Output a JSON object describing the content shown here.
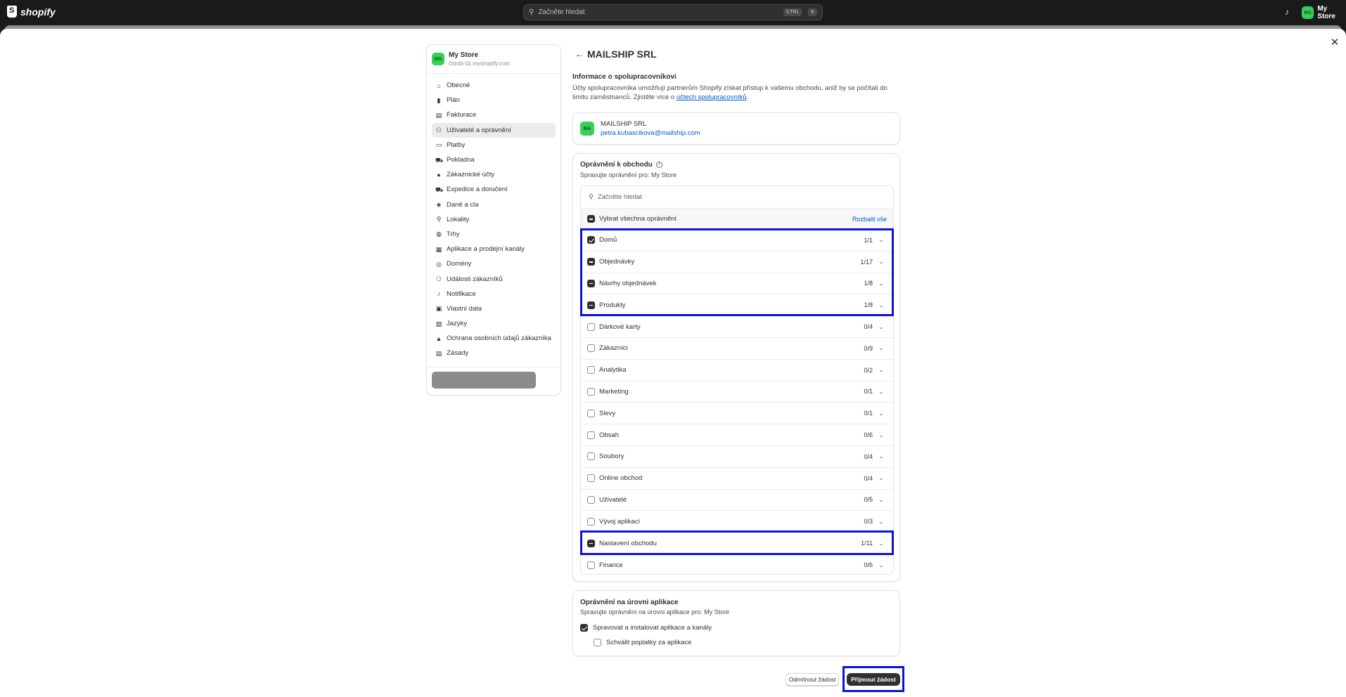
{
  "topbar": {
    "logo_text": "shopify",
    "search_placeholder": "Začněte hledat",
    "kbd1": "CTRL",
    "kbd2": "K",
    "store_initials": "MS",
    "store_name": "My Store"
  },
  "sidebar": {
    "store_initials": "MS",
    "store_name": "My Store",
    "store_domain": "0xtvbi-0z.myshopify.com",
    "items": [
      {
        "label": "Obecné",
        "icon": "store-icon",
        "glyph": "⌂"
      },
      {
        "label": "Plán",
        "icon": "plan-chart-icon",
        "glyph": "▮"
      },
      {
        "label": "Fakturace",
        "icon": "billing-icon",
        "glyph": "▤"
      },
      {
        "label": "Uživatelé a oprávnění",
        "icon": "users-icon",
        "glyph": "⚇"
      },
      {
        "label": "Platby",
        "icon": "payments-icon",
        "glyph": "▭"
      },
      {
        "label": "Pokladna",
        "icon": "checkout-cart-icon",
        "glyph": "⛟"
      },
      {
        "label": "Zákaznické účty",
        "icon": "customer-account-icon",
        "glyph": "●"
      },
      {
        "label": "Expedice a doručení",
        "icon": "truck-icon",
        "glyph": "⛟"
      },
      {
        "label": "Daně a cla",
        "icon": "taxes-icon",
        "glyph": "◈"
      },
      {
        "label": "Lokality",
        "icon": "location-pin-icon",
        "glyph": "⚲"
      },
      {
        "label": "Trhy",
        "icon": "globe-icon",
        "glyph": "◍"
      },
      {
        "label": "Aplikace a prodejní kanály",
        "icon": "apps-icon",
        "glyph": "▦"
      },
      {
        "label": "Domény",
        "icon": "domains-globe-icon",
        "glyph": "◎"
      },
      {
        "label": "Události zákazníků",
        "icon": "customer-events-icon",
        "glyph": "⚆"
      },
      {
        "label": "Notifikace",
        "icon": "notification-bell-icon",
        "glyph": "♪"
      },
      {
        "label": "Vlastní data",
        "icon": "custom-data-icon",
        "glyph": "▣"
      },
      {
        "label": "Jazyky",
        "icon": "languages-icon",
        "glyph": "▧"
      },
      {
        "label": "Ochrana osobních údajů zákazníka",
        "icon": "lock-icon",
        "glyph": "▲"
      },
      {
        "label": "Zásady",
        "icon": "policies-icon",
        "glyph": "▤"
      }
    ]
  },
  "main": {
    "back_glyph": "←",
    "title": "MAILSHIP SRL",
    "info_heading": "Informace o spolupracovníkovi",
    "info_text": "Účty spolupracovníka umožňují partnerům Shopify získat přístup k vašemu obchodu, aniž by se počítali do limitu zaměstnanců. Zjistěte více o ",
    "info_link": "účtech spolupracovníků",
    "info_end": ".",
    "collaborator": {
      "initials": "MA",
      "name": "MAILSHIP SRL",
      "email": "petra.kubascikova@mailship.com"
    }
  },
  "permissions": {
    "heading": "Oprávnění k obchodu",
    "subtitle": "Spravujte oprávnění pro: My Store",
    "search_placeholder": "Začněte hledat",
    "select_all": "Vybrat všechna oprávnění",
    "expand_all": "Rozbalit vše",
    "rows": [
      {
        "label": "Domů",
        "count": "1/1",
        "state": "on"
      },
      {
        "label": "Objednávky",
        "count": "1/17",
        "state": "mixed"
      },
      {
        "label": "Návrhy objednávek",
        "count": "1/8",
        "state": "mixed"
      },
      {
        "label": "Produkty",
        "count": "1/8",
        "state": "mixed"
      },
      {
        "label": "Dárkové karty",
        "count": "0/4",
        "state": "off"
      },
      {
        "label": "Zákazníci",
        "count": "0/9",
        "state": "off"
      },
      {
        "label": "Analytika",
        "count": "0/2",
        "state": "off"
      },
      {
        "label": "Marketing",
        "count": "0/1",
        "state": "off"
      },
      {
        "label": "Slevy",
        "count": "0/1",
        "state": "off"
      },
      {
        "label": "Obsah",
        "count": "0/6",
        "state": "off"
      },
      {
        "label": "Soubory",
        "count": "0/4",
        "state": "off"
      },
      {
        "label": "Online obchod",
        "count": "0/4",
        "state": "off"
      },
      {
        "label": "Uživatelé",
        "count": "0/5",
        "state": "off"
      },
      {
        "label": "Vývoj aplikací",
        "count": "0/3",
        "state": "off"
      },
      {
        "label": "Nastavení obchodu",
        "count": "1/11",
        "state": "mixed"
      },
      {
        "label": "Finance",
        "count": "0/6",
        "state": "off"
      }
    ]
  },
  "app_permissions": {
    "heading": "Oprávnění na úrovni aplikace",
    "subtitle": "Spravujte oprávnění na úrovni aplikace pro: My Store",
    "manage_label": "Spravovat a instalovat aplikace a kanály",
    "approve_label": "Schválit poplatky za aplikace"
  },
  "actions": {
    "decline": "Odmítnout žádost",
    "accept": "Přijmout žádost"
  },
  "colors": {
    "highlight": "#0a13d6",
    "link": "#005bd3",
    "avatar": "#36d05a"
  }
}
